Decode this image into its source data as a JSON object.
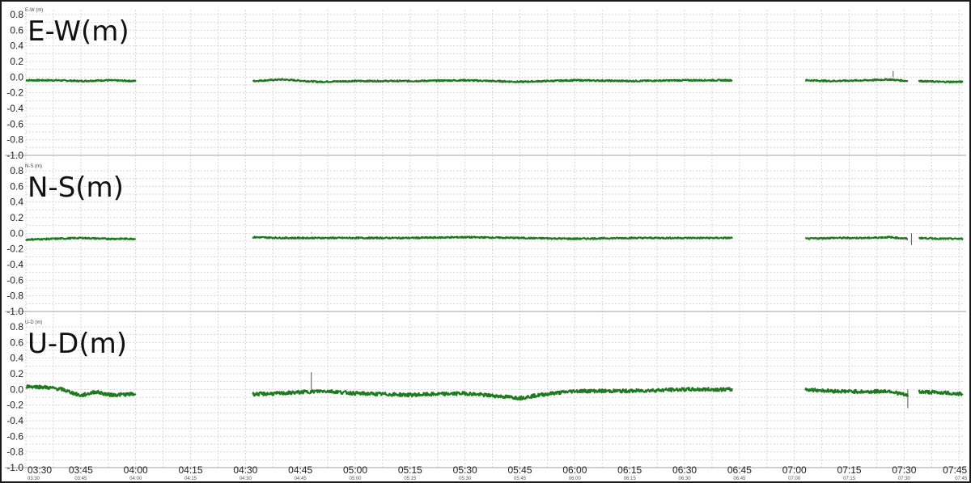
{
  "chart_data": {
    "type": "line",
    "grid": true,
    "x_range": [
      "03:30",
      "07:46"
    ],
    "x_ticks": [
      "03:30",
      "03:45",
      "04:00",
      "04:15",
      "04:30",
      "04:45",
      "05:00",
      "05:15",
      "05:30",
      "05:45",
      "06:00",
      "06:15",
      "06:30",
      "06:45",
      "07:00",
      "07:15",
      "07:30",
      "07:45"
    ],
    "x_ticks_minutes": [
      210,
      225,
      240,
      255,
      270,
      285,
      300,
      315,
      330,
      345,
      360,
      375,
      390,
      405,
      420,
      435,
      450,
      465
    ],
    "data_segments_minutes": [
      [
        210,
        240
      ],
      [
        272,
        403
      ],
      [
        423,
        451
      ],
      [
        454,
        466
      ]
    ],
    "color": "#1f7a1f",
    "panels": [
      {
        "label": "E-W(m)",
        "mini_label": "E-W (m)",
        "ylim": [
          -1.0,
          0.8
        ],
        "y_ticks": [
          "0.8",
          "0.6",
          "0.4",
          "0.2",
          "0.0",
          "-0.2",
          "-0.4",
          "-0.6",
          "-0.8",
          "-1.0"
        ],
        "series": [
          {
            "values": [
              [
                210,
                -0.04
              ],
              [
                218,
                -0.04
              ],
              [
                225,
                -0.05
              ],
              [
                232,
                -0.04
              ],
              [
                240,
                -0.05
              ]
            ]
          },
          {
            "values": [
              [
                272,
                -0.05
              ],
              [
                280,
                -0.03
              ],
              [
                290,
                -0.06
              ],
              [
                300,
                -0.05
              ],
              [
                315,
                -0.05
              ],
              [
                330,
                -0.04
              ],
              [
                345,
                -0.06
              ],
              [
                360,
                -0.04
              ],
              [
                375,
                -0.05
              ],
              [
                390,
                -0.04
              ],
              [
                403,
                -0.04
              ]
            ]
          },
          {
            "values": [
              [
                423,
                -0.04
              ],
              [
                430,
                -0.05
              ],
              [
                440,
                -0.04
              ],
              [
                446,
                -0.03
              ],
              [
                451,
                -0.05
              ]
            ]
          },
          {
            "values": [
              [
                454,
                -0.05
              ],
              [
                460,
                -0.06
              ],
              [
                466,
                -0.06
              ]
            ]
          }
        ],
        "spikes": [
          {
            "x": 447,
            "y": 0.08
          }
        ]
      },
      {
        "label": "N-S(m)",
        "mini_label": "N-S (m)",
        "ylim": [
          -1.0,
          0.8
        ],
        "y_ticks": [
          "0.8",
          "0.6",
          "0.4",
          "0.2",
          "0.0",
          "-0.2",
          "-0.4",
          "-0.6",
          "-0.8",
          "-1.0"
        ],
        "series": [
          {
            "values": [
              [
                210,
                -0.08
              ],
              [
                218,
                -0.07
              ],
              [
                225,
                -0.06
              ],
              [
                232,
                -0.07
              ],
              [
                240,
                -0.07
              ]
            ]
          },
          {
            "values": [
              [
                272,
                -0.05
              ],
              [
                280,
                -0.06
              ],
              [
                290,
                -0.06
              ],
              [
                300,
                -0.06
              ],
              [
                315,
                -0.06
              ],
              [
                330,
                -0.05
              ],
              [
                345,
                -0.06
              ],
              [
                360,
                -0.07
              ],
              [
                375,
                -0.06
              ],
              [
                390,
                -0.06
              ],
              [
                403,
                -0.06
              ]
            ]
          },
          {
            "values": [
              [
                423,
                -0.07
              ],
              [
                430,
                -0.06
              ],
              [
                440,
                -0.06
              ],
              [
                446,
                -0.05
              ],
              [
                451,
                -0.07
              ]
            ]
          },
          {
            "values": [
              [
                454,
                -0.06
              ],
              [
                460,
                -0.07
              ],
              [
                466,
                -0.07
              ]
            ]
          }
        ],
        "spikes": [
          {
            "x": 288,
            "y": 0.01
          },
          {
            "x": 452,
            "y": -0.15
          }
        ]
      },
      {
        "label": "U-D(m)",
        "mini_label": "U-D (m)",
        "ylim": [
          -1.0,
          0.8
        ],
        "y_ticks": [
          "0.8",
          "0.6",
          "0.4",
          "0.2",
          "0.0",
          "-0.2",
          "-0.4",
          "-0.6",
          "-0.8",
          "-1.0"
        ],
        "series": [
          {
            "values": [
              [
                210,
                0.04
              ],
              [
                215,
                0.03
              ],
              [
                220,
                0.0
              ],
              [
                225,
                -0.08
              ],
              [
                229,
                -0.03
              ],
              [
                233,
                -0.07
              ],
              [
                240,
                -0.06
              ]
            ]
          },
          {
            "values": [
              [
                272,
                -0.06
              ],
              [
                280,
                -0.05
              ],
              [
                287,
                -0.03
              ],
              [
                292,
                -0.02
              ],
              [
                300,
                -0.05
              ],
              [
                315,
                -0.07
              ],
              [
                330,
                -0.05
              ],
              [
                345,
                -0.11
              ],
              [
                352,
                -0.06
              ],
              [
                360,
                -0.02
              ],
              [
                375,
                -0.02
              ],
              [
                390,
                0.0
              ],
              [
                403,
                0.0
              ]
            ]
          },
          {
            "values": [
              [
                423,
                0.0
              ],
              [
                430,
                -0.02
              ],
              [
                440,
                -0.03
              ],
              [
                446,
                -0.02
              ],
              [
                451,
                -0.08
              ]
            ]
          },
          {
            "values": [
              [
                454,
                -0.03
              ],
              [
                460,
                -0.04
              ],
              [
                466,
                -0.06
              ]
            ]
          }
        ],
        "spikes": [
          {
            "x": 288,
            "y": 0.22
          },
          {
            "x": 451,
            "y": -0.24
          }
        ]
      }
    ]
  }
}
